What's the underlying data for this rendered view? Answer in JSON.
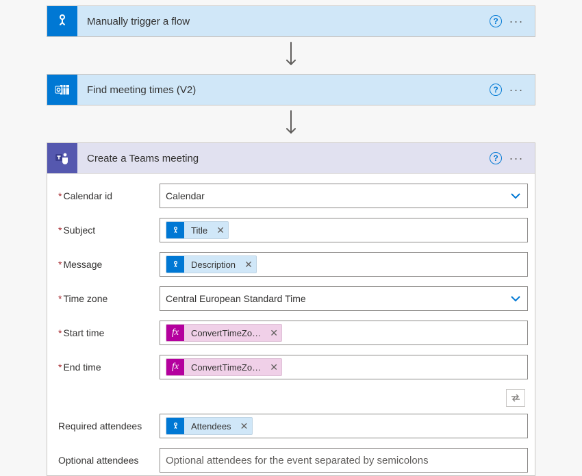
{
  "triggers": {
    "manual": {
      "title": "Manually trigger a flow"
    },
    "findMeeting": {
      "title": "Find meeting times (V2)"
    }
  },
  "action": {
    "title": "Create a Teams meeting",
    "fields": {
      "calendarId": {
        "label": "Calendar id",
        "value": "Calendar"
      },
      "subject": {
        "label": "Subject",
        "token": "Title"
      },
      "message": {
        "label": "Message",
        "token": "Description"
      },
      "timeZone": {
        "label": "Time zone",
        "value": "Central European Standard Time"
      },
      "startTime": {
        "label": "Start time",
        "token": "ConvertTimeZo…"
      },
      "endTime": {
        "label": "End time",
        "token": "ConvertTimeZo…"
      },
      "required": {
        "label": "Required attendees",
        "token": "Attendees"
      },
      "optional": {
        "label": "Optional attendees",
        "placeholder": "Optional attendees for the event separated by semicolons"
      }
    }
  },
  "glyphs": {
    "fx": "fx"
  }
}
